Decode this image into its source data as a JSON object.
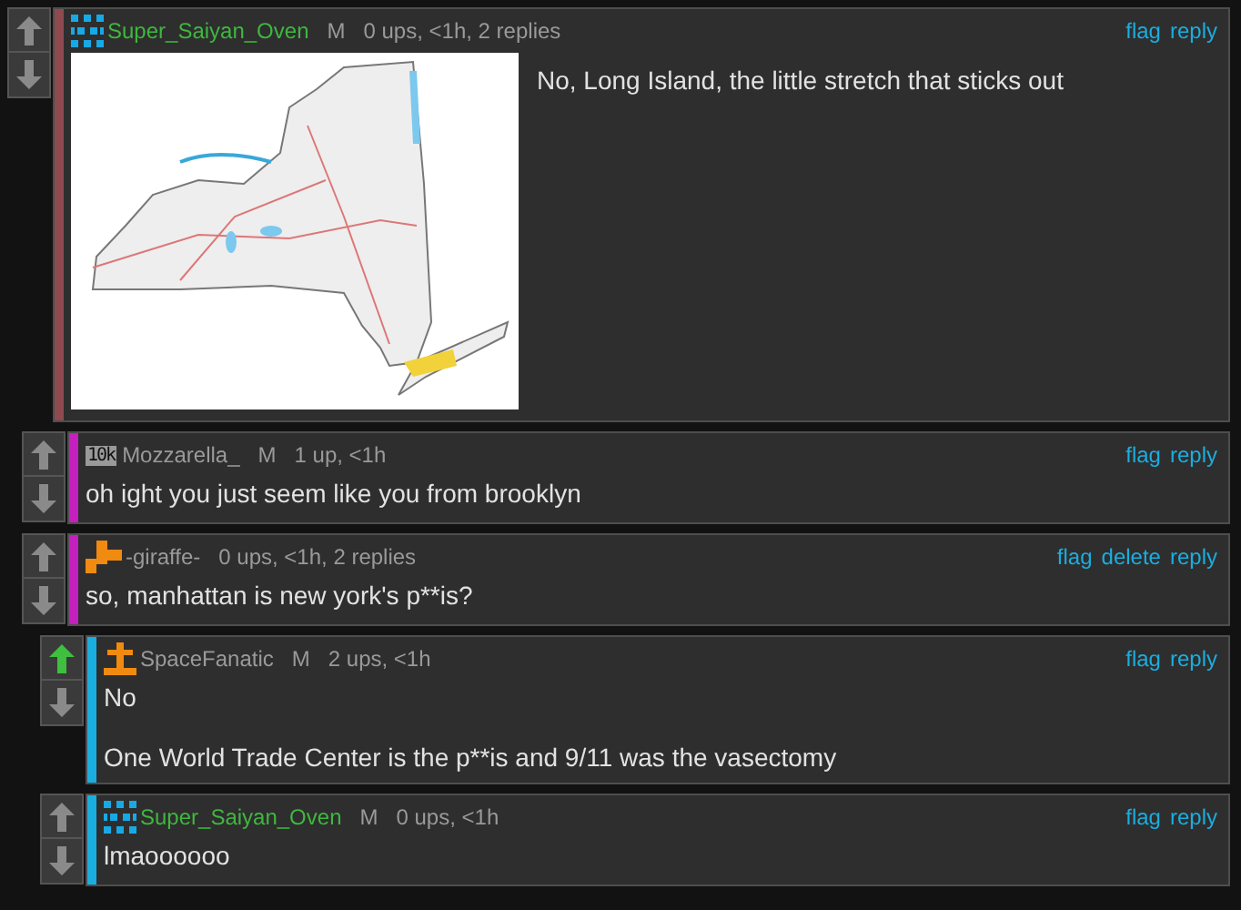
{
  "comments": [
    {
      "upvoted": false,
      "color": "#8f4a4f",
      "avatar": {
        "kind": "grid"
      },
      "username": "Super_Saiyan_Oven",
      "username_highlight": true,
      "gender": "M",
      "meta": "0 ups, <1h, 2 replies",
      "actions": [
        "flag",
        "reply"
      ],
      "image": {
        "kind": "picture"
      },
      "body": [
        "No, Long Island, the little stretch that sticks out"
      ],
      "children": [
        {
          "upvoted": false,
          "color": "#c51fc0",
          "avatar": {
            "kind": "text",
            "text": "10k"
          },
          "username": "Mozzarella_",
          "username_highlight": false,
          "gender": "M",
          "meta": "1 up, <1h",
          "actions": [
            "flag",
            "reply"
          ],
          "body": [
            "oh ight you just seem like you from brooklyn"
          ]
        },
        {
          "upvoted": false,
          "color": "#c51fc0",
          "avatar": {
            "kind": "blocks"
          },
          "username": "-giraffe-",
          "username_highlight": false,
          "meta": "0 ups, <1h, 2 replies",
          "actions": [
            "flag",
            "delete",
            "reply"
          ],
          "body": [
            "so, manhattan is new york's p**is?"
          ],
          "children": [
            {
              "upvoted": true,
              "color": "#1aaee0",
              "avatar": {
                "kind": "cross"
              },
              "username": "SpaceFanatic",
              "username_highlight": false,
              "gender": "M",
              "meta": "2 ups, <1h",
              "actions": [
                "flag",
                "reply"
              ],
              "body": [
                "No",
                "One World Trade Center is the p**is and 9/11 was the vasectomy"
              ]
            },
            {
              "upvoted": false,
              "color": "#1aaee0",
              "avatar": {
                "kind": "grid"
              },
              "username": "Super_Saiyan_Oven",
              "username_highlight": true,
              "gender": "M",
              "meta": "0 ups, <1h",
              "actions": [
                "flag",
                "reply"
              ],
              "body": [
                "lmaoooooo"
              ]
            }
          ]
        }
      ]
    }
  ]
}
